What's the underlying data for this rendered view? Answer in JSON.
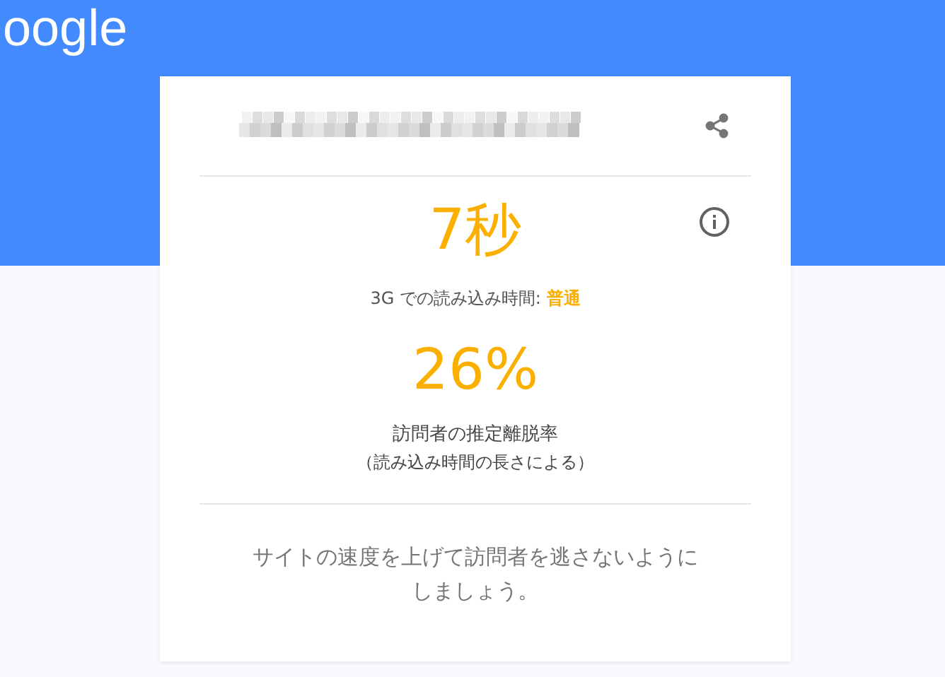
{
  "header": {
    "logo": "oogle"
  },
  "card": {
    "load_time": "7秒",
    "load_time_caption": "3G での読み込み時間: **普通**",
    "bounce_rate": "26%",
    "bounce_caption": "訪問者の推定離脱率",
    "bounce_note": "（読み込み時間の長さによる）",
    "advice": [
      "サイトの速度を上げて訪問者を逃さないように",
      "しましょう。"
    ]
  }
}
